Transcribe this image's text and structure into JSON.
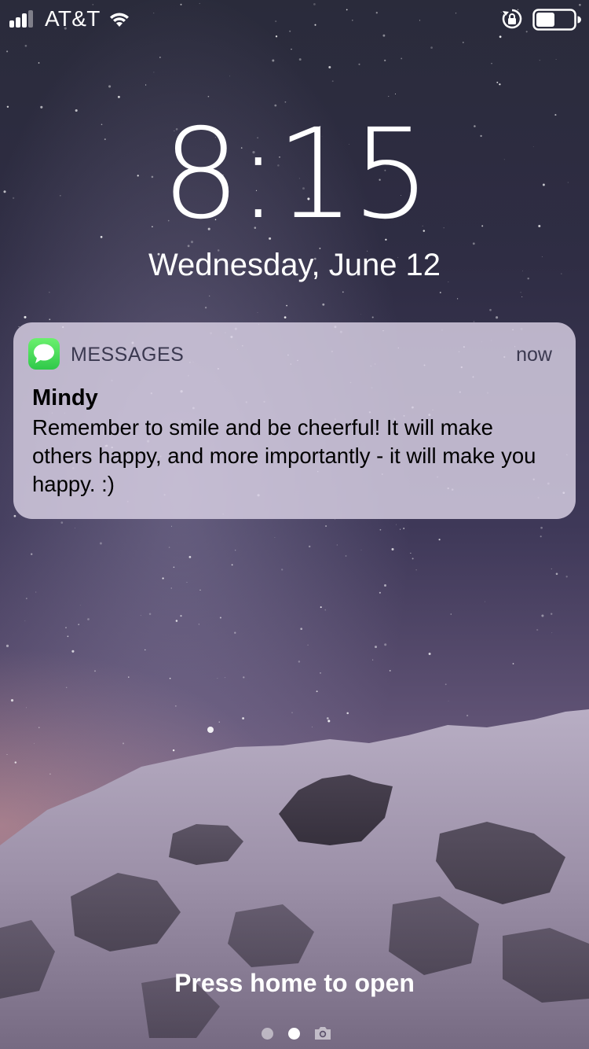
{
  "status_bar": {
    "carrier": "AT&T",
    "signal_bars_filled": 3,
    "signal_bars_total": 5,
    "battery_level": 0.5,
    "icons": [
      "signal-icon",
      "wifi-icon",
      "rotation-lock-icon",
      "battery-icon"
    ]
  },
  "lock_screen": {
    "time": "8:15",
    "date": "Wednesday, June 12",
    "unlock_hint": "Press home to open",
    "page_dots": 2,
    "current_page": 2
  },
  "notification": {
    "app_name": "MESSAGES",
    "app_icon": "messages-icon",
    "time": "now",
    "sender": "Mindy",
    "body": "Remember to smile and be cheerful! It will make others happy, and more importantly - it will make you happy. :)"
  },
  "colors": {
    "notification_bg": "#d6cee2",
    "messages_green": "#35cc4b",
    "text_primary": "#000000",
    "text_secondary": "#3b3950"
  }
}
